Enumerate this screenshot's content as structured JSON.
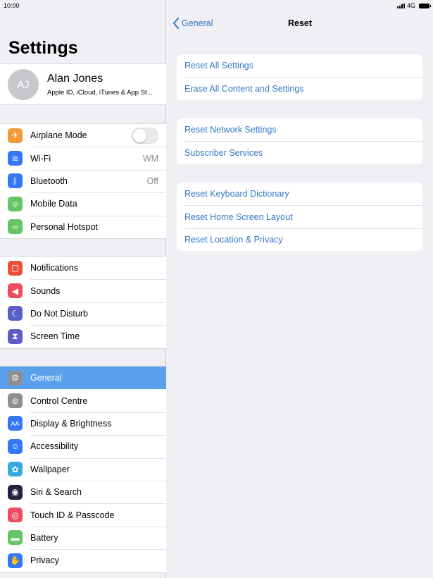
{
  "status": {
    "time": "10:00",
    "network": "4G"
  },
  "sidebar": {
    "title": "Settings",
    "profile": {
      "initials": "AJ",
      "name": "Alan Jones",
      "subtitle": "Apple ID, iCloud, iTunes & App St..."
    },
    "group1": [
      {
        "label": "Airplane Mode",
        "icon": "airplane-icon",
        "color": "#f19a37",
        "toggle": false
      },
      {
        "label": "Wi-Fi",
        "icon": "wifi-icon",
        "color": "#3478f6",
        "value": "WM"
      },
      {
        "label": "Bluetooth",
        "icon": "bluetooth-icon",
        "color": "#3478f6",
        "value": "Off"
      },
      {
        "label": "Mobile Data",
        "icon": "antenna-icon",
        "color": "#65c466"
      },
      {
        "label": "Personal Hotspot",
        "icon": "hotspot-icon",
        "color": "#65c466"
      }
    ],
    "group2": [
      {
        "label": "Notifications",
        "icon": "notifications-icon",
        "color": "#eb4e3d"
      },
      {
        "label": "Sounds",
        "icon": "speaker-icon",
        "color": "#eb4e5f"
      },
      {
        "label": "Do Not Disturb",
        "icon": "moon-icon",
        "color": "#5b5fc7"
      },
      {
        "label": "Screen Time",
        "icon": "hourglass-icon",
        "color": "#5b5fc7"
      }
    ],
    "group3": [
      {
        "label": "General",
        "icon": "gear-icon",
        "color": "#8e8e93",
        "selected": true
      },
      {
        "label": "Control Centre",
        "icon": "switches-icon",
        "color": "#8e8e93"
      },
      {
        "label": "Display & Brightness",
        "icon": "text-size-icon",
        "color": "#3478f6"
      },
      {
        "label": "Accessibility",
        "icon": "accessibility-icon",
        "color": "#3478f6"
      },
      {
        "label": "Wallpaper",
        "icon": "flower-icon",
        "color": "#36aadc"
      },
      {
        "label": "Siri & Search",
        "icon": "siri-icon",
        "color": "#222244"
      },
      {
        "label": "Touch ID & Passcode",
        "icon": "fingerprint-icon",
        "color": "#eb4e5f"
      },
      {
        "label": "Battery",
        "icon": "battery-icon",
        "color": "#65c466"
      },
      {
        "label": "Privacy",
        "icon": "hand-icon",
        "color": "#3478f6"
      }
    ]
  },
  "detail": {
    "back_label": "General",
    "title": "Reset",
    "groups": [
      [
        "Reset All Settings",
        "Erase All Content and Settings"
      ],
      [
        "Reset Network Settings",
        "Subscriber Services"
      ],
      [
        "Reset Keyboard Dictionary",
        "Reset Home Screen Layout",
        "Reset Location & Privacy"
      ]
    ]
  }
}
